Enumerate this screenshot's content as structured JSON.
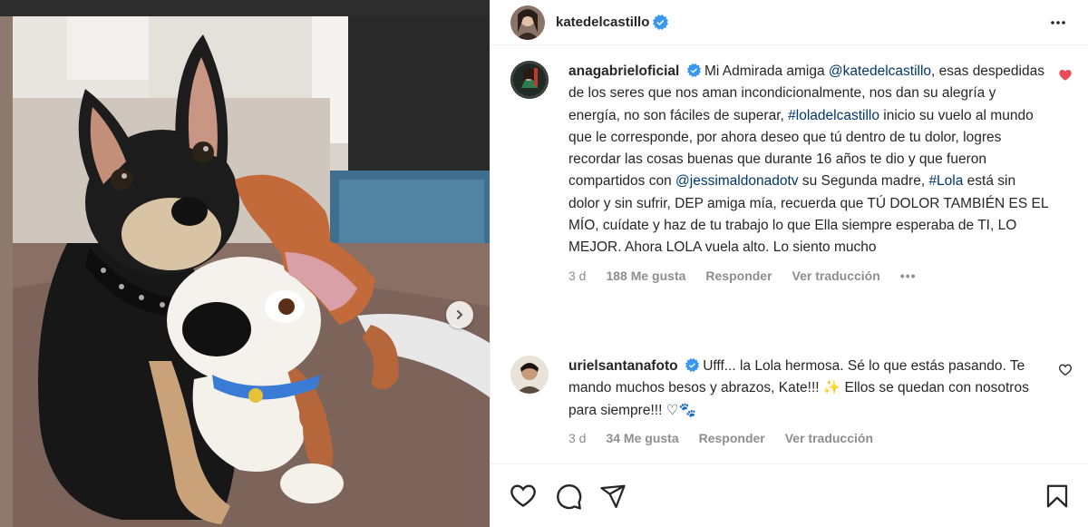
{
  "post": {
    "author": "katedelcastillo",
    "image_alt": "Chihuahua negro junto a peluche de perro"
  },
  "comments": [
    {
      "user": "anagabrieloficial",
      "text_parts": [
        {
          "t": " Mi Admirada amiga "
        },
        {
          "t": "@katedelcastillo",
          "link": true
        },
        {
          "t": ", esas despedidas de los seres que nos aman incondicionalmente, nos dan su alegría y energía, no son fáciles de superar, "
        },
        {
          "t": "#loladelcastillo",
          "link": true
        },
        {
          "t": " inicio su vuelo al mundo que le corresponde, por ahora deseo que tú dentro de tu dolor, logres recordar las cosas buenas que durante 16 años te dio y que fueron compartidos con "
        },
        {
          "t": "@jessimaldonadotv",
          "link": true
        },
        {
          "t": " su Segunda madre, "
        },
        {
          "t": "#Lola",
          "link": true
        },
        {
          "t": " está sin dolor y sin sufrir, DEP amiga mía, recuerda que TÚ DOLOR TAMBIÉN ES EL MÍO, cuídate y haz de tu trabajo lo que Ella siempre esperaba de TI, LO MEJOR. Ahora LOLA vuela alto. Lo siento mucho"
        }
      ],
      "time": "3 d",
      "likes": "188 Me gusta",
      "reply": "Responder",
      "translate": "Ver traducción",
      "more": "•••",
      "liked": true
    },
    {
      "user": "urielsantanafoto",
      "text_parts": [
        {
          "t": " Ufff... la Lola hermosa. Sé lo que estás pasando. Te mando muchos besos y abrazos, Kate!!! ✨ Ellos se quedan con nosotros para siempre!!! ♡🐾"
        }
      ],
      "time": "3 d",
      "likes": "34 Me gusta",
      "reply": "Responder",
      "translate": "Ver traducción",
      "liked": false
    }
  ],
  "colors": {
    "verified": "#3897f0",
    "liked_heart": "#ed4956",
    "link": "#00376b",
    "meta": "#8e8e8e"
  },
  "icons": [
    "verified-badge-icon",
    "more-options-icon",
    "heart-icon",
    "comment-icon",
    "share-icon",
    "bookmark-icon",
    "chevron-right-icon"
  ]
}
